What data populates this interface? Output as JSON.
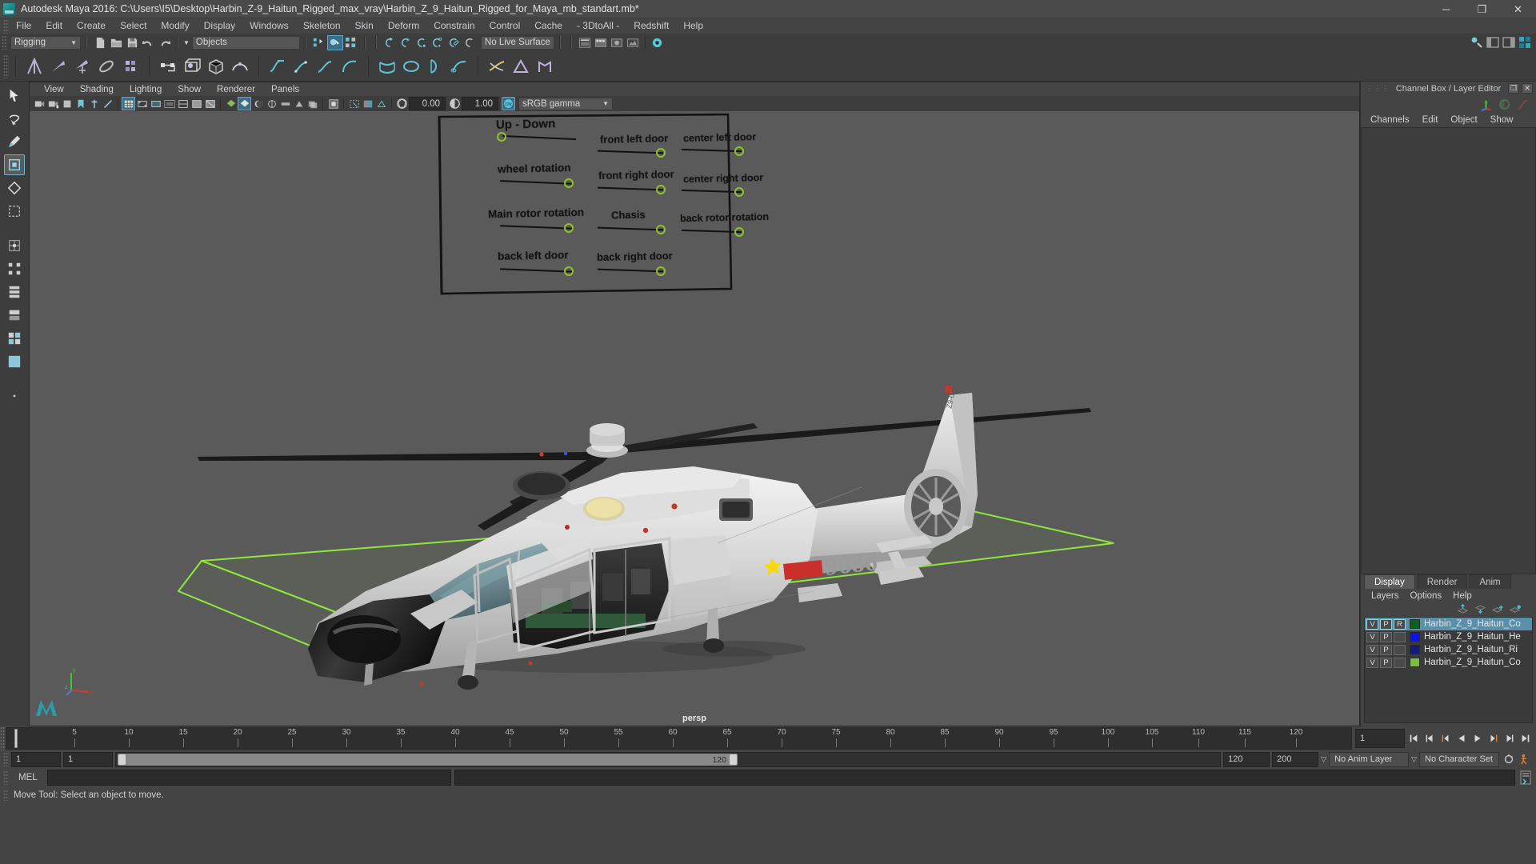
{
  "window": {
    "title": "Autodesk Maya 2016: C:\\Users\\I5\\Desktop\\Harbin_Z-9_Haitun_Rigged_max_vray\\Harbin_Z_9_Haitun_Rigged_for_Maya_mb_standart.mb*",
    "minimize": "─",
    "maximize": "❐",
    "close": "✕"
  },
  "menubar": {
    "items": [
      "File",
      "Edit",
      "Create",
      "Select",
      "Modify",
      "Display",
      "Windows",
      "Skeleton",
      "Skin",
      "Deform",
      "Constrain",
      "Control",
      "Cache",
      "- 3DtoAll -",
      "Redshift",
      "Help"
    ]
  },
  "statusline": {
    "menuset": "Rigging",
    "selection_mask": "Objects",
    "live_surface": "No Live Surface"
  },
  "viewport_menu": {
    "items": [
      "View",
      "Shading",
      "Lighting",
      "Show",
      "Renderer",
      "Panels"
    ]
  },
  "viewport_toolbar": {
    "exposure": "0.00",
    "gamma": "1.00",
    "toggle": "ON",
    "view_transform": "sRGB gamma"
  },
  "viewport": {
    "camera_label": "persp",
    "axis": {
      "x": "x",
      "y": "y",
      "z": "z"
    }
  },
  "rig_controls": {
    "items": [
      {
        "label": "Up - Down",
        "knob": "left"
      },
      {
        "label": "front left door",
        "knob": "right"
      },
      {
        "label": "center left door",
        "knob": "right"
      },
      {
        "label": "wheel rotation",
        "knob": "right"
      },
      {
        "label": "front right door",
        "knob": "right"
      },
      {
        "label": "center right door",
        "knob": "right"
      },
      {
        "label": "Main rotor rotation",
        "knob": "right"
      },
      {
        "label": "Chasis",
        "knob": "right"
      },
      {
        "label": "back rotor rotation",
        "knob": "right"
      },
      {
        "label": "back left door",
        "knob": "right"
      },
      {
        "label": "back right door",
        "knob": "right"
      }
    ],
    "knob_color": "#8fc325"
  },
  "channel_box": {
    "title": "Channel Box / Layer Editor",
    "menus": [
      "Channels",
      "Edit",
      "Object",
      "Show"
    ]
  },
  "layer_editor": {
    "tabs": [
      "Display",
      "Render",
      "Anim"
    ],
    "active_tab": "Display",
    "menus": [
      "Layers",
      "Options",
      "Help"
    ],
    "column_v": "V",
    "column_p": "P",
    "column_r": "R",
    "layers": [
      {
        "name": "Harbin_Z_9_Haitun_Co",
        "color": "#04641e",
        "v": "V",
        "p": "P",
        "r": "R",
        "selected": true
      },
      {
        "name": "Harbin_Z_9_Haitun_He",
        "color": "#0a12f0",
        "v": "V",
        "p": "P",
        "r": "",
        "selected": false
      },
      {
        "name": "Harbin_Z_9_Haitun_Ri",
        "color": "#131a82",
        "v": "V",
        "p": "P",
        "r": "",
        "selected": false
      },
      {
        "name": "Harbin_Z_9_Haitun_Co",
        "color": "#7cbd3c",
        "v": "V",
        "p": "P",
        "r": "",
        "selected": false
      }
    ]
  },
  "timeline": {
    "ticks": [
      5,
      10,
      15,
      20,
      25,
      30,
      35,
      40,
      45,
      50,
      55,
      60,
      65,
      70,
      75,
      80,
      85,
      90,
      95,
      100,
      105,
      110,
      115,
      120
    ],
    "current_frame": "1",
    "frame_field": "1",
    "range_start": "1",
    "range_end": "1",
    "range_bar_start": "1",
    "range_bar_end": "120",
    "playback_end": "120",
    "animation_end": "200",
    "anim_layer": "No Anim Layer",
    "character_set": "No Character Set"
  },
  "command_line": {
    "label": "MEL",
    "input": "",
    "output": ""
  },
  "helpline": {
    "text": "Move Tool: Select an object to move."
  },
  "helicopter": {
    "tail_code": "Z9-0186",
    "fuselage_number": "9686"
  }
}
